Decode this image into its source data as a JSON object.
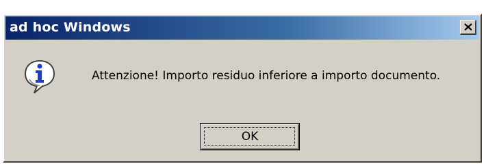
{
  "window": {
    "title": "ad hoc Windows",
    "close_icon": "close-x-icon"
  },
  "message": {
    "icon": "info-icon",
    "text": "Attenzione! Importo residuo inferiore a importo documento."
  },
  "buttons": {
    "ok_label": "OK"
  },
  "colors": {
    "titlebar_start": "#0a246a",
    "titlebar_end": "#a6caf0",
    "dialog_face": "#d4d0c8",
    "icon_blue": "#1f3fbf"
  }
}
